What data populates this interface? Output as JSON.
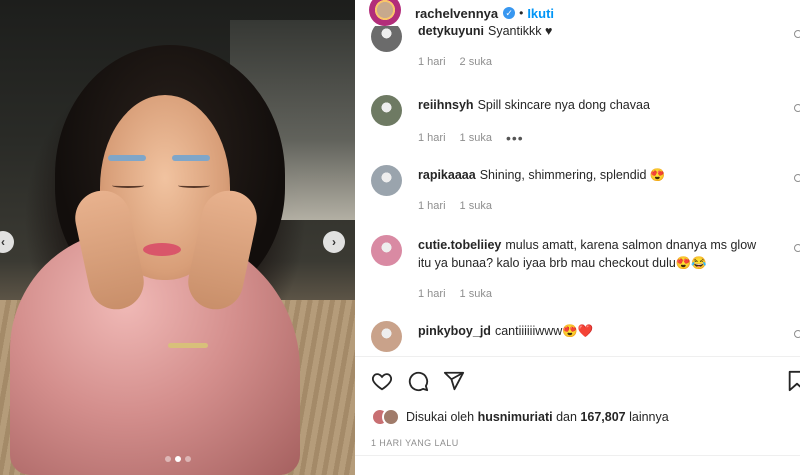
{
  "post": {
    "username": "rachelvennya",
    "separator": "•",
    "follow_label": "Ikuti",
    "likes_prefix": "Disukai oleh",
    "likes_user": "husnimuriati",
    "likes_mid": "dan",
    "likes_count": "167,807",
    "likes_suffix": "lainnya",
    "timestamp": "1 HARI YANG LALU",
    "carousel_total_dots": 3,
    "carousel_active_dot": 1
  },
  "comments": [
    {
      "handle": "detyku̇yuni",
      "text": "Syantikkk ♥",
      "time": "1 hari",
      "likes": "2 suka",
      "more": "",
      "avatar_color": "#6b6b6b"
    },
    {
      "handle": "reiihnsyh",
      "text": "Spill skincare nya dong chavaa",
      "time": "1 hari",
      "likes": "1 suka",
      "more": "•••",
      "avatar_color": "#6e7a63"
    },
    {
      "handle": "rapikaaaa",
      "text": "Shining, shimmering, splendid 😍",
      "time": "1 hari",
      "likes": "1 suka",
      "more": "",
      "avatar_color": "#9aa4ad"
    },
    {
      "handle": "cutie.tobeliiey",
      "text": "mulus amatt, karena salmon dnanya ms glow itu ya bunaa? kalo iyaa brb mau checkout dulu😍😂",
      "time": "1 hari",
      "likes": "1 suka",
      "more": "",
      "avatar_color": "#d98aa3"
    },
    {
      "handle": "pinkyboy_jd",
      "text": "cantiiiiiiwww😍❤️",
      "time": "",
      "likes": "",
      "more": "",
      "avatar_color": "#c9a28a"
    }
  ],
  "icons": {
    "like": "heart-icon",
    "comment": "comment-icon",
    "share": "share-icon",
    "save": "bookmark-icon",
    "prev": "chevron-left-icon",
    "next": "chevron-right-icon",
    "verified": "verified-badge-icon"
  },
  "glyphs": {
    "prev": "‹",
    "next": "›",
    "verified": "✓"
  },
  "colors": {
    "accent": "#0095f6",
    "verified": "#3897f0",
    "meta": "#8e8e8e"
  }
}
